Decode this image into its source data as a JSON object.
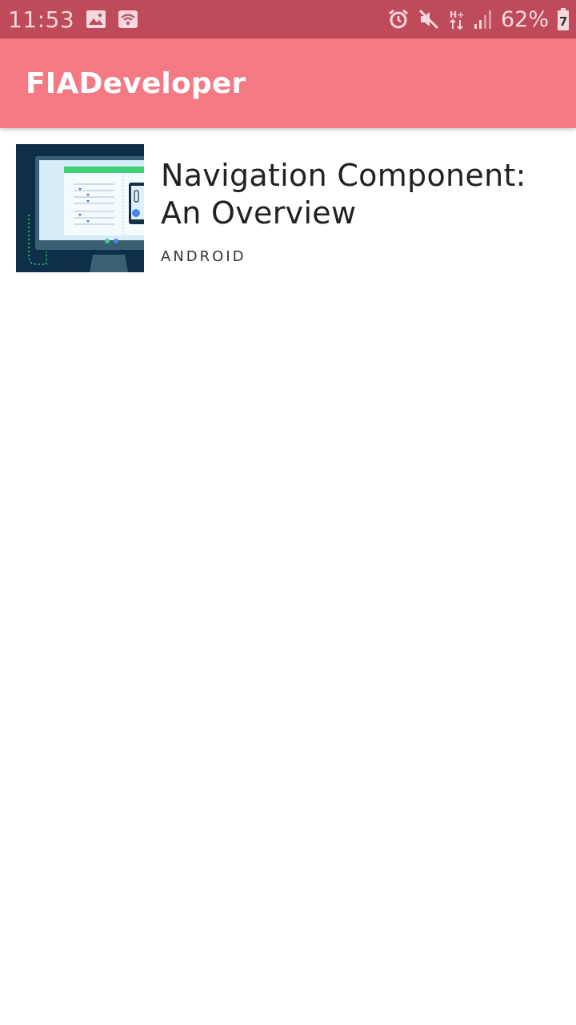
{
  "status_bar": {
    "time": "11:53",
    "battery_percent": "62%",
    "battery_level_glyph": "7",
    "left_icons": [
      "image-icon",
      "wifi-hotspot-icon"
    ],
    "right_icons": [
      "alarm-icon",
      "mute-icon",
      "hplus-data-icon",
      "signal-icon",
      "battery-icon"
    ],
    "background": "#bf4a5a"
  },
  "app_bar": {
    "title": "FIADeveloper",
    "background": "#f37a85"
  },
  "articles": [
    {
      "title": "Navigation Component: An Overview",
      "category": "ANDROID",
      "thumbnail_icon": "navigation-illustration-thumbnail"
    }
  ]
}
